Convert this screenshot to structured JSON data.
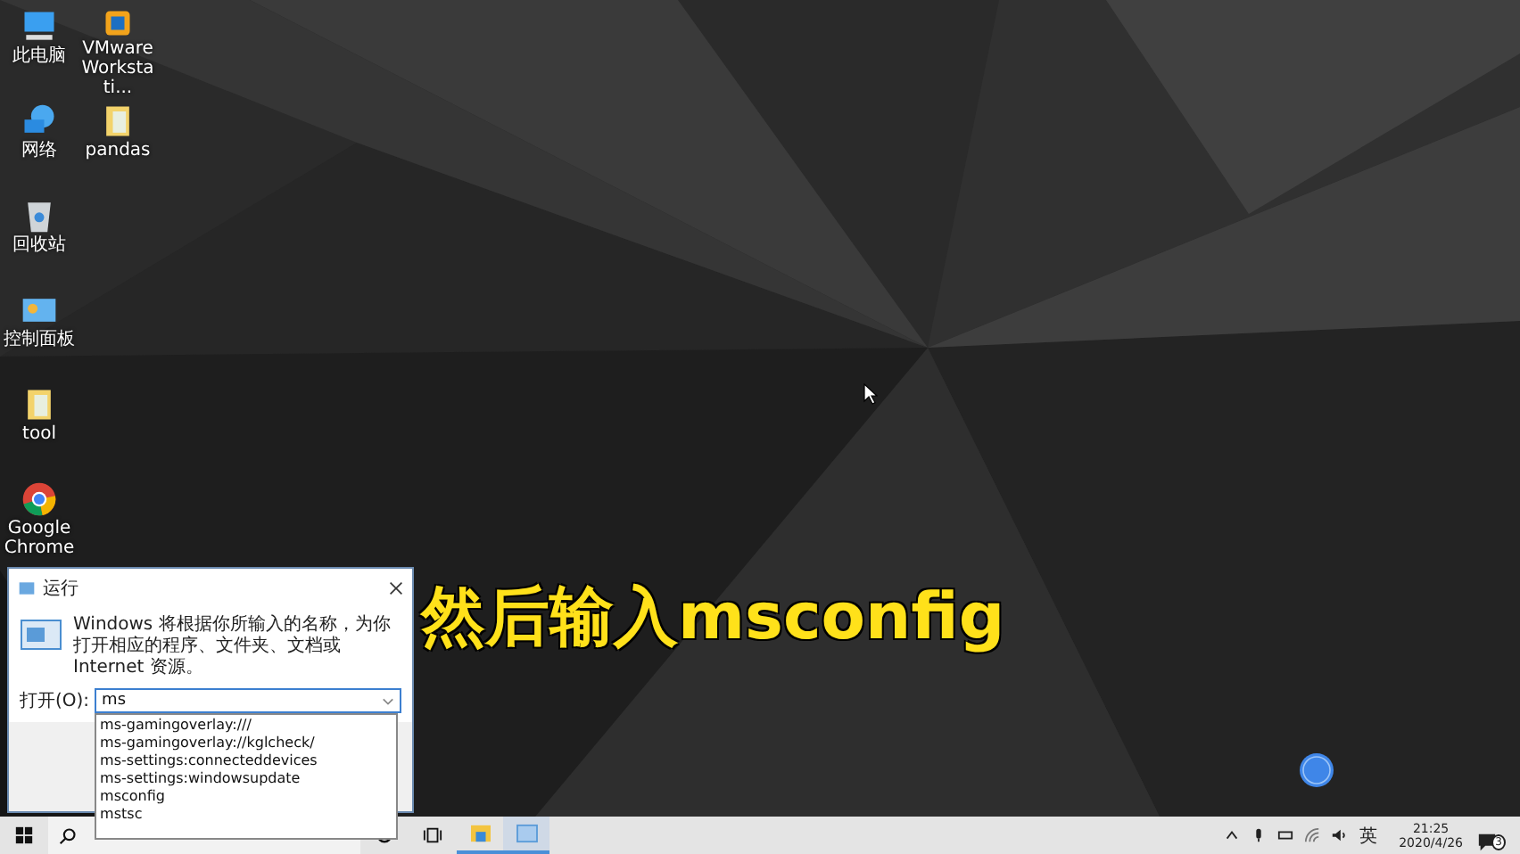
{
  "desktop_icons": [
    {
      "label": "此电脑",
      "kind": "computer"
    },
    {
      "label": "网络",
      "kind": "network"
    },
    {
      "label": "回收站",
      "kind": "recycle"
    },
    {
      "label": "控制面板",
      "kind": "control"
    },
    {
      "label": "tool",
      "kind": "folder"
    },
    {
      "label": "Google Chrome",
      "kind": "chrome"
    },
    {
      "label": "VMware Workstati...",
      "kind": "vmware"
    },
    {
      "label": "pandas",
      "kind": "folder"
    }
  ],
  "caption": "然后输入msconfig",
  "run_dialog": {
    "title": "运行",
    "description": "Windows 将根据你所输入的名称，为你打开相应的程序、文件夹、文档或 Internet 资源。",
    "open_label": "打开(O):",
    "value": "ms",
    "suggestions": [
      "ms-gamingoverlay:///",
      "ms-gamingoverlay://kglcheck/",
      "ms-settings:connecteddevices",
      "ms-settings:windowsupdate",
      "msconfig",
      "mstsc"
    ]
  },
  "taskbar": {
    "apps": [
      {
        "kind": "explorer",
        "running": true,
        "selected": false
      },
      {
        "kind": "run",
        "running": true,
        "selected": true
      }
    ],
    "input_method": "英",
    "time": "21:25",
    "date": "2020/4/26",
    "notification_count": "3"
  }
}
